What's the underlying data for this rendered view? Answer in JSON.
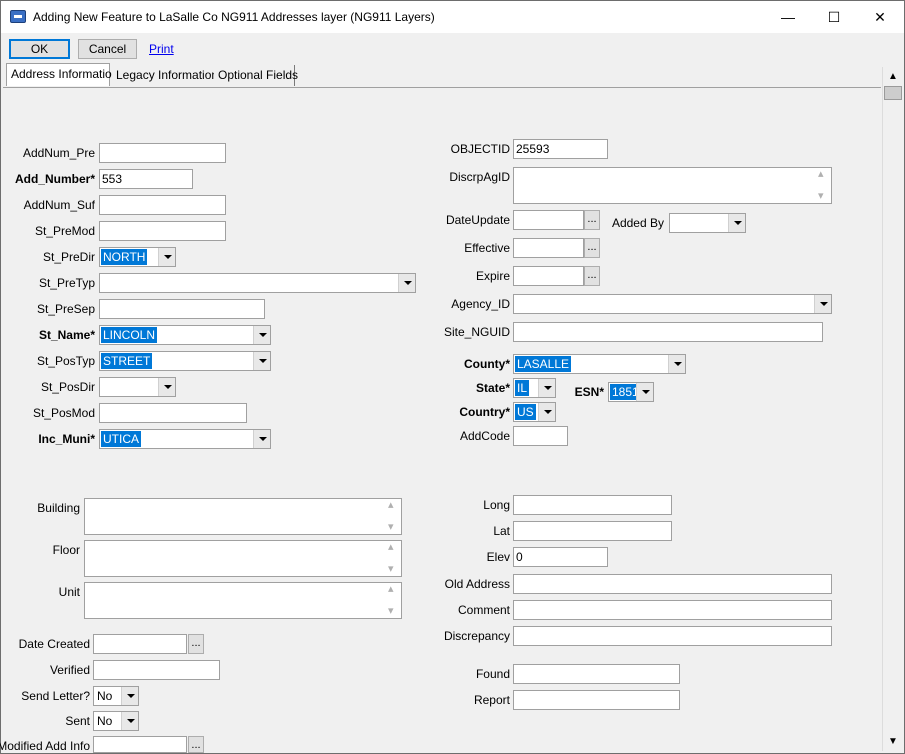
{
  "window": {
    "title": "Adding New Feature to LaSalle Co NG911 Addresses layer  (NG911 Layers)",
    "minimize": "—",
    "maximize": "☐",
    "close": "✕",
    "icon": "layer-app-icon"
  },
  "toolbar": {
    "ok": "OK",
    "cancel": "Cancel",
    "print": "Print"
  },
  "tabs": [
    "Address Information",
    "Legacy Information",
    "Optional Fields"
  ],
  "left": {
    "addnum_pre": {
      "label": "AddNum_Pre",
      "value": ""
    },
    "add_number": {
      "label": "Add_Number*",
      "value": "553"
    },
    "addnum_suf": {
      "label": "AddNum_Suf",
      "value": ""
    },
    "st_premod": {
      "label": "St_PreMod",
      "value": ""
    },
    "st_predir": {
      "label": "St_PreDir",
      "value": "NORTH"
    },
    "st_pretyp": {
      "label": "St_PreTyp",
      "value": ""
    },
    "st_presep": {
      "label": "St_PreSep",
      "value": ""
    },
    "st_name": {
      "label": "St_Name*",
      "value": "LINCOLN"
    },
    "st_postyp": {
      "label": "St_PosTyp",
      "value": "STREET"
    },
    "st_posdir": {
      "label": "St_PosDir",
      "value": ""
    },
    "st_posmod": {
      "label": "St_PosMod",
      "value": ""
    },
    "inc_muni": {
      "label": "Inc_Muni*",
      "value": "UTICA"
    },
    "building": {
      "label": "Building",
      "value": ""
    },
    "floor": {
      "label": "Floor",
      "value": ""
    },
    "unit": {
      "label": "Unit",
      "value": ""
    },
    "date_created": {
      "label": "Date Created",
      "value": ""
    },
    "verified": {
      "label": "Verified",
      "value": ""
    },
    "send_letter": {
      "label": "Send Letter?",
      "value": "No"
    },
    "sent": {
      "label": "Sent",
      "value": "No"
    },
    "modified_add_info": {
      "label": "Modified Add Info",
      "value": ""
    }
  },
  "right": {
    "objectid": {
      "label": "OBJECTID",
      "value": "25593"
    },
    "discrpagid": {
      "label": "DiscrpAgID",
      "value": ""
    },
    "dateupdate": {
      "label": "DateUpdate",
      "value": ""
    },
    "added_by": {
      "label": "Added By",
      "value": ""
    },
    "effective": {
      "label": "Effective",
      "value": ""
    },
    "expire": {
      "label": "Expire",
      "value": ""
    },
    "agency_id": {
      "label": "Agency_ID",
      "value": ""
    },
    "site_nguid": {
      "label": "Site_NGUID",
      "value": ""
    },
    "county": {
      "label": "County*",
      "value": "LASALLE"
    },
    "state": {
      "label": "State*",
      "value": "IL"
    },
    "esn": {
      "label": "ESN*",
      "value": "1851"
    },
    "country": {
      "label": "Country*",
      "value": "US"
    },
    "addcode": {
      "label": "AddCode",
      "value": ""
    },
    "long": {
      "label": "Long",
      "value": ""
    },
    "lat": {
      "label": "Lat",
      "value": ""
    },
    "elev": {
      "label": "Elev",
      "value": "0"
    },
    "old_address": {
      "label": "Old Address",
      "value": ""
    },
    "comment": {
      "label": "Comment",
      "value": ""
    },
    "discrepancy": {
      "label": "Discrepancy",
      "value": ""
    },
    "found": {
      "label": "Found",
      "value": ""
    },
    "report": {
      "label": "Report",
      "value": ""
    }
  },
  "ellipsis": "..."
}
